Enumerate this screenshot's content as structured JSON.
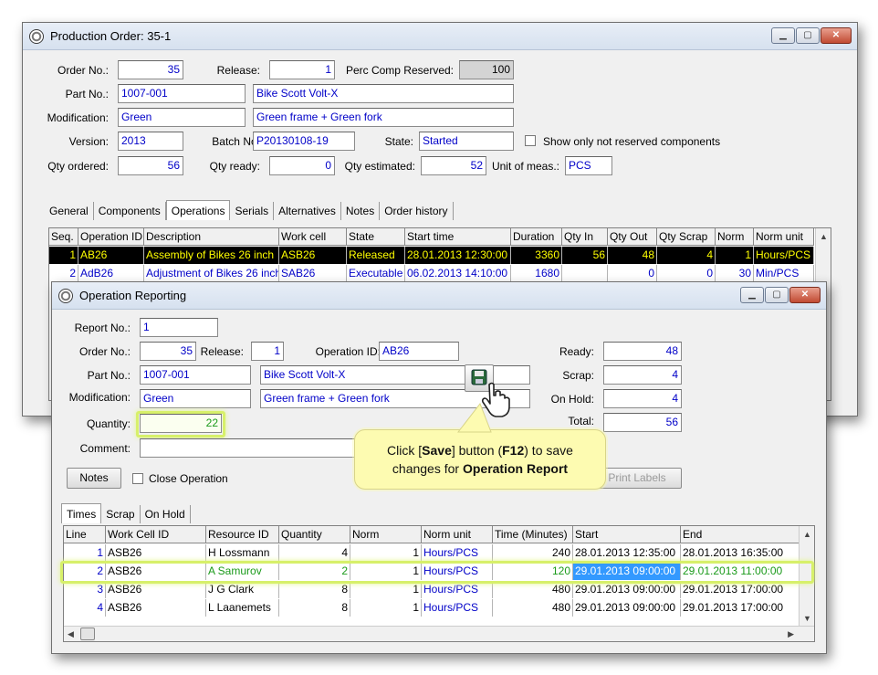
{
  "production_order": {
    "title": "Production Order: 35-1",
    "order_no_label": "Order No.:",
    "order_no": "35",
    "release_label": "Release:",
    "release": "1",
    "perc_comp_label": "Perc Comp Reserved:",
    "perc_comp": "100",
    "part_no_label": "Part No.:",
    "part_no": "1007-001",
    "part_desc": "Bike Scott Volt-X",
    "modification_label": "Modification:",
    "modification": "Green",
    "modification_desc": "Green frame + Green fork",
    "version_label": "Version:",
    "version": "2013",
    "batch_label": "Batch No:",
    "batch": "P20130108-19",
    "state_label": "State:",
    "state": "Started",
    "show_only_label": "Show only not reserved components",
    "qty_ordered_label": "Qty ordered:",
    "qty_ordered": "56",
    "qty_ready_label": "Qty ready:",
    "qty_ready": "0",
    "qty_estimated_label": "Qty estimated:",
    "qty_estimated": "52",
    "uom_label": "Unit of meas.:",
    "uom": "PCS",
    "tabs": [
      "General",
      "Components",
      "Operations",
      "Serials",
      "Alternatives",
      "Notes",
      "Order history"
    ],
    "active_tab": "Operations",
    "ops_columns": [
      "Seq.",
      "Operation ID",
      "Description",
      "Work cell",
      "State",
      "Start time",
      "Duration",
      "Qty In",
      "Qty Out",
      "Qty Scrap",
      "Norm",
      "Norm unit"
    ],
    "ops_rows": [
      [
        "1",
        "AB26",
        "Assembly of Bikes 26 inch",
        "ASB26",
        "Released",
        "28.01.2013 12:30:00",
        "3360",
        "56",
        "48",
        "4",
        "1",
        "Hours/PCS"
      ],
      [
        "2",
        "AdB26",
        "Adjustment of Bikes 26 inch",
        "SAB26",
        "Executable",
        "06.02.2013 14:10:00",
        "1680",
        "",
        "0",
        "0",
        "30",
        "Min/PCS"
      ]
    ]
  },
  "operation_reporting": {
    "title": "Operation Reporting",
    "report_no_label": "Report No.:",
    "report_no": "1",
    "order_no_label": "Order No.:",
    "order_no": "35",
    "release_label": "Release:",
    "release": "1",
    "operation_id_label": "Operation ID:",
    "operation_id": "AB26",
    "part_no_label": "Part No.:",
    "part_no": "1007-001",
    "part_desc": "Bike Scott Volt-X",
    "modification_label": "Modification:",
    "modification": "Green",
    "modification_desc": "Green frame + Green fork",
    "quantity_label": "Quantity:",
    "quantity": "22",
    "comment_label": "Comment:",
    "comment": "",
    "ready_label": "Ready:",
    "ready": "48",
    "scrap_label": "Scrap:",
    "scrap": "4",
    "on_hold_label": "On Hold:",
    "on_hold": "4",
    "total_label": "Total:",
    "total": "56",
    "notes_button": "Notes",
    "close_operation_label": "Close Operation",
    "print_labels_button": "Print Labels",
    "tabs": [
      "Times",
      "Scrap",
      "On Hold"
    ],
    "active_tab": "Times",
    "times_columns": [
      "Line",
      "Work Cell ID",
      "Resource ID",
      "Quantity",
      "Norm",
      "Norm unit",
      "Time (Minutes)",
      "Start",
      "End"
    ],
    "times_rows": [
      [
        "1",
        "ASB26",
        "H Lossmann",
        "4",
        "1",
        "Hours/PCS",
        "240",
        "28.01.2013 12:35:00",
        "28.01.2013 16:35:00"
      ],
      [
        "2",
        "ASB26",
        "A Samurov",
        "2",
        "1",
        "Hours/PCS",
        "120",
        "29.01.2013 09:00:00",
        "29.01.2013 11:00:00"
      ],
      [
        "3",
        "ASB26",
        "J G Clark",
        "8",
        "1",
        "Hours/PCS",
        "480",
        "29.01.2013 09:00:00",
        "29.01.2013 17:00:00"
      ],
      [
        "4",
        "ASB26",
        "L Laanemets",
        "8",
        "1",
        "Hours/PCS",
        "480",
        "29.01.2013 09:00:00",
        "29.01.2013 17:00:00"
      ]
    ]
  },
  "callout": {
    "line1_prefix": "Click [",
    "line1_bold": "Save",
    "line1_mid": "] button (",
    "line1_bold2": "F12",
    "line1_suffix": ") to save",
    "line2_prefix": "changes for ",
    "line2_bold": "Operation Report"
  },
  "icons": [
    "window-icon",
    "save-icon",
    "hand-cursor-icon",
    "minimize-icon",
    "maximize-icon",
    "close-icon"
  ],
  "colors": {
    "field_text": "#0000c8",
    "selected_row_bg": "#000000",
    "selected_row_text": "#ffff00",
    "highlight": "#d7f06a",
    "callout_bg": "#fdfbb1"
  }
}
